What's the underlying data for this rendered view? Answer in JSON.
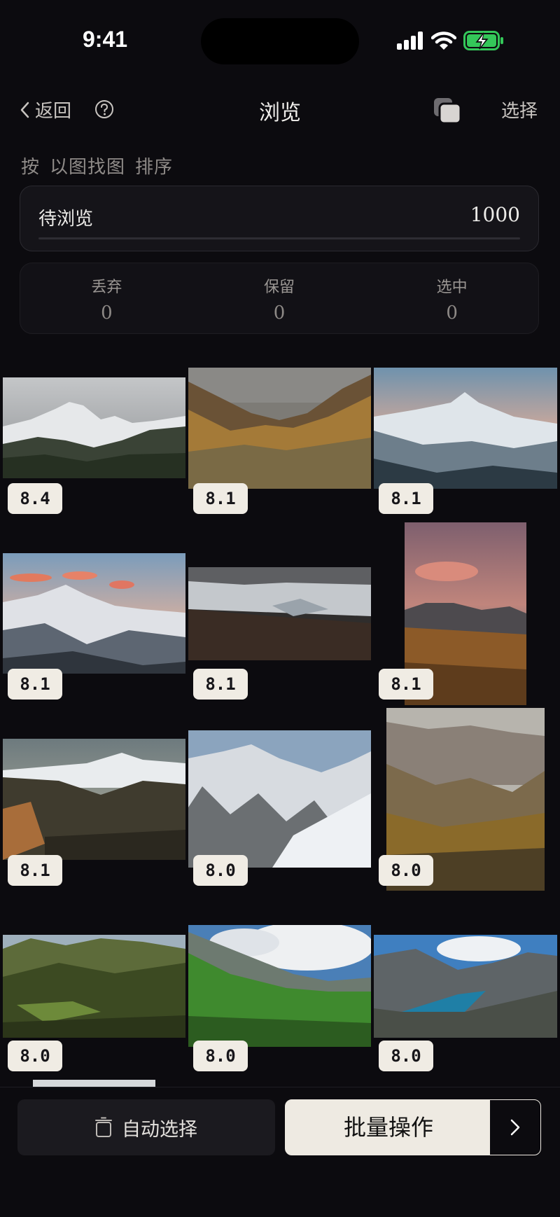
{
  "status_bar": {
    "time": "9:41"
  },
  "nav": {
    "back_label": "返回",
    "title": "浏览",
    "select_label": "选择"
  },
  "sort": {
    "prefix": "按",
    "method": "以图找图",
    "suffix": "排序"
  },
  "pending": {
    "label": "待浏览",
    "value": "1000"
  },
  "stats": [
    {
      "label": "丢弃",
      "value": "0"
    },
    {
      "label": "保留",
      "value": "0"
    },
    {
      "label": "选中",
      "value": "0"
    }
  ],
  "photos": [
    {
      "score": "8.4"
    },
    {
      "score": "8.1"
    },
    {
      "score": "8.1"
    },
    {
      "score": "8.1"
    },
    {
      "score": "8.1"
    },
    {
      "score": "8.1"
    },
    {
      "score": "8.1"
    },
    {
      "score": "8.0"
    },
    {
      "score": "8.0"
    },
    {
      "score": "8.0"
    },
    {
      "score": "8.0"
    },
    {
      "score": "8.0"
    }
  ],
  "bottom_bar": {
    "auto_select_label": "自动选择",
    "batch_label": "批量操作"
  },
  "colors": {
    "background": "#0c0b0f",
    "accent_button": "#eeeae2",
    "battery": "#34c759"
  }
}
